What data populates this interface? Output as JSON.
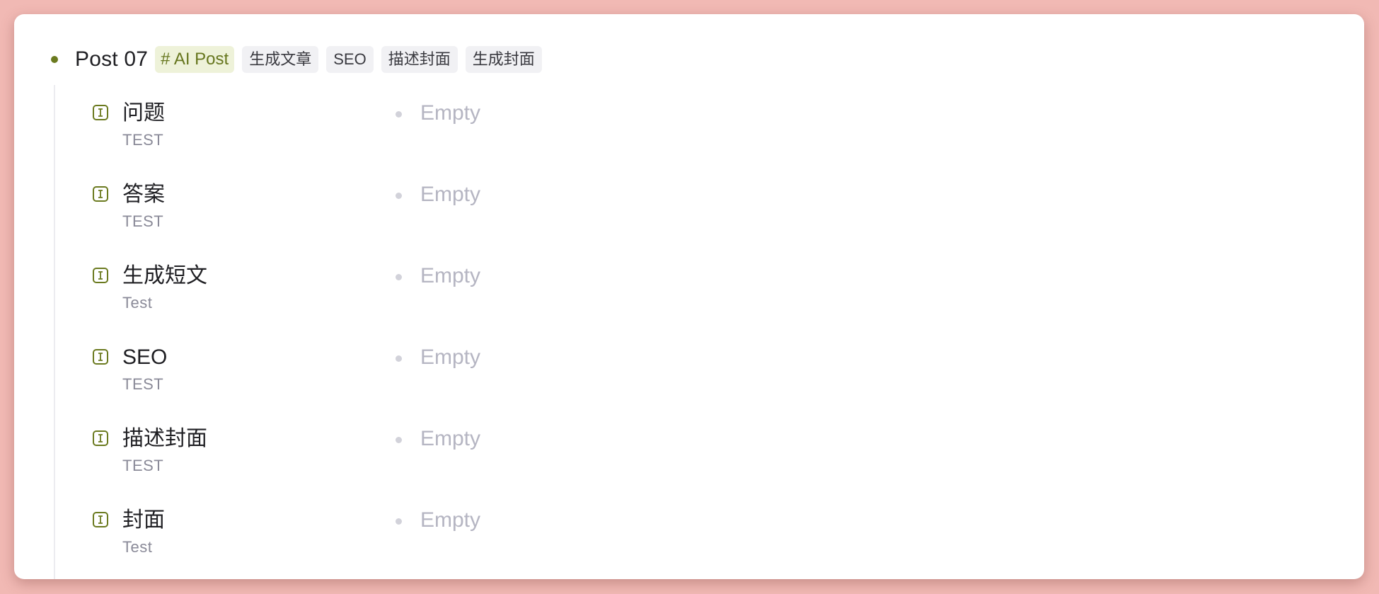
{
  "node": {
    "title": "Post 07",
    "supertag": "# AI Post",
    "tags": [
      "生成文章",
      "SEO",
      "描述封面",
      "生成封面"
    ]
  },
  "fields": [
    {
      "name": "问题",
      "description": "TEST",
      "value": "Empty",
      "icon": "text-field-icon"
    },
    {
      "name": "答案",
      "description": "TEST",
      "value": "Empty",
      "icon": "text-field-icon"
    },
    {
      "name": "生成短文",
      "description": "Test",
      "value": "Empty",
      "icon": "text-field-icon"
    },
    {
      "name": "SEO",
      "description": "TEST",
      "value": "Empty",
      "icon": "text-field-icon"
    },
    {
      "name": "描述封面",
      "description": "TEST",
      "value": "Empty",
      "icon": "text-field-icon"
    },
    {
      "name": "封面",
      "description": "Test",
      "value": "Empty",
      "icon": "text-field-icon"
    }
  ],
  "colors": {
    "background": "#f1b9b4",
    "accent": "#6b7a1f",
    "supertag_bg": "#eef2d9",
    "tag_bg": "#f1f1f4",
    "placeholder": "#b5b5c2"
  }
}
